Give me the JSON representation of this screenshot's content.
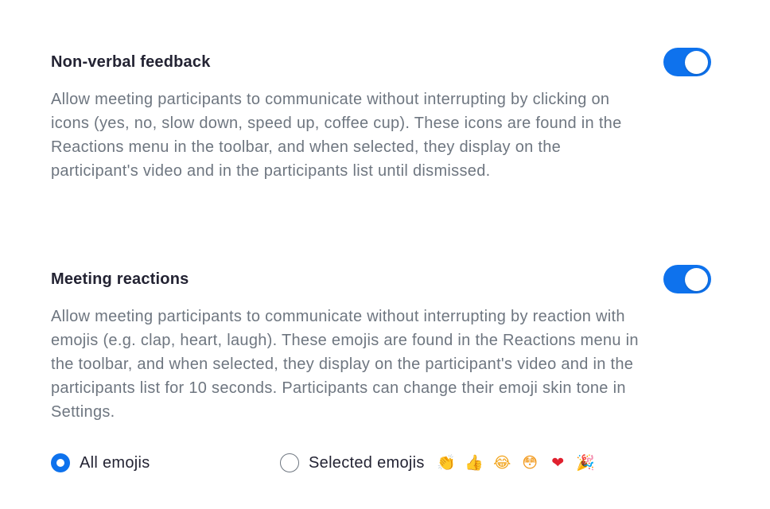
{
  "settings": [
    {
      "title": "Non-verbal feedback",
      "description": "Allow meeting participants to communicate without interrupting by clicking on icons (yes, no, slow down, speed up, coffee cup). These icons are found in the Reactions menu in the toolbar, and when selected, they display on the participant's video and in the participants list until dismissed.",
      "enabled": true
    },
    {
      "title": "Meeting reactions",
      "description": "Allow meeting participants to communicate without interrupting by reaction with emojis (e.g. clap, heart, laugh). These emojis are found in the Reactions menu in the toolbar, and when selected, they display on the participant's video and in the participants list for 10 seconds. Participants can change their emoji skin tone in Settings.",
      "enabled": true
    }
  ],
  "reactions_options": {
    "all_label": "All emojis",
    "selected_label": "Selected emojis",
    "selected_value": "all",
    "emojis": [
      {
        "name": "clapping-hands-emoji",
        "glyph": "👏"
      },
      {
        "name": "thumbs-up-emoji",
        "glyph": "👍"
      },
      {
        "name": "tears-of-joy-emoji",
        "glyph": "😂"
      },
      {
        "name": "astonished-face-emoji",
        "glyph": "😳"
      },
      {
        "name": "red-heart-emoji",
        "glyph": "❤"
      },
      {
        "name": "party-popper-emoji",
        "glyph": "🎉"
      }
    ]
  },
  "colors": {
    "accent": "#0e72ed",
    "title_text": "#232333",
    "body_text": "#6e7680"
  }
}
